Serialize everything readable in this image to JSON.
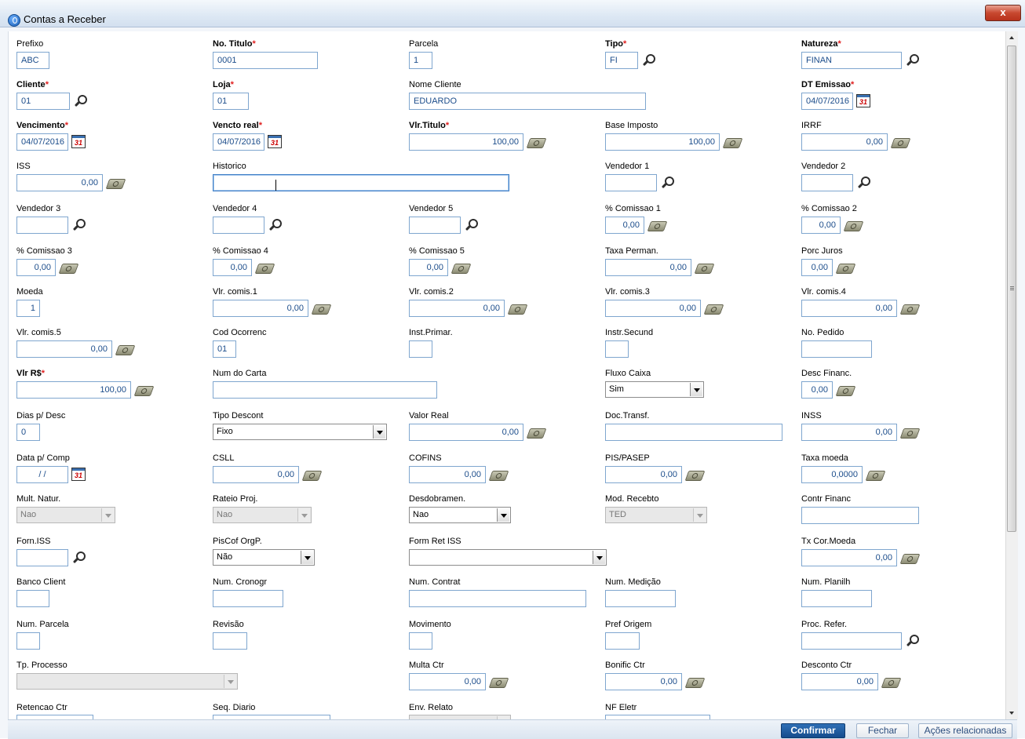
{
  "window": {
    "title": "Contas a Receber",
    "close_glyph": "x"
  },
  "fields": {
    "prefixo": {
      "label": "Prefixo",
      "value": "ABC"
    },
    "no_titulo": {
      "label": "No. Titulo",
      "value": "0001"
    },
    "parcela": {
      "label": "Parcela",
      "value": "1"
    },
    "tipo": {
      "label": "Tipo",
      "value": "FI"
    },
    "natureza": {
      "label": "Natureza",
      "value": "FINAN"
    },
    "cliente": {
      "label": "Cliente",
      "value": "01"
    },
    "loja": {
      "label": "Loja",
      "value": "01"
    },
    "nome_cliente": {
      "label": "Nome Cliente",
      "value": "EDUARDO"
    },
    "dt_emissao": {
      "label": "DT Emissao",
      "value": "04/07/2016"
    },
    "vencimento": {
      "label": "Vencimento",
      "value": "04/07/2016"
    },
    "vencto_real": {
      "label": "Vencto real",
      "value": "04/07/2016"
    },
    "vlr_titulo": {
      "label": "Vlr.Titulo",
      "value": "100,00"
    },
    "base_imposto": {
      "label": "Base Imposto",
      "value": "100,00"
    },
    "irrf": {
      "label": "IRRF",
      "value": "0,00"
    },
    "iss": {
      "label": "ISS",
      "value": "0,00"
    },
    "historico": {
      "label": "Historico",
      "value": ""
    },
    "vendedor1": {
      "label": "Vendedor 1",
      "value": ""
    },
    "vendedor2": {
      "label": "Vendedor 2",
      "value": ""
    },
    "vendedor3": {
      "label": "Vendedor 3",
      "value": ""
    },
    "vendedor4": {
      "label": "Vendedor 4",
      "value": ""
    },
    "vendedor5": {
      "label": "Vendedor 5",
      "value": ""
    },
    "comissao1": {
      "label": "% Comissao 1",
      "value": "0,00"
    },
    "comissao2": {
      "label": "% Comissao 2",
      "value": "0,00"
    },
    "comissao3": {
      "label": "% Comissao 3",
      "value": "0,00"
    },
    "comissao4": {
      "label": "% Comissao 4",
      "value": "0,00"
    },
    "comissao5": {
      "label": "% Comissao 5",
      "value": "0,00"
    },
    "taxa_perman": {
      "label": "Taxa Perman.",
      "value": "0,00"
    },
    "porc_juros": {
      "label": "Porc Juros",
      "value": "0,00"
    },
    "moeda": {
      "label": "Moeda",
      "value": "1"
    },
    "vlr_comis1": {
      "label": "Vlr. comis.1",
      "value": "0,00"
    },
    "vlr_comis2": {
      "label": "Vlr. comis.2",
      "value": "0,00"
    },
    "vlr_comis3": {
      "label": "Vlr. comis.3",
      "value": "0,00"
    },
    "vlr_comis4": {
      "label": "Vlr. comis.4",
      "value": "0,00"
    },
    "vlr_comis5": {
      "label": "Vlr. comis.5",
      "value": "0,00"
    },
    "cod_ocorrenc": {
      "label": "Cod Ocorrenc",
      "value": "01"
    },
    "inst_primar": {
      "label": "Inst.Primar.",
      "value": ""
    },
    "instr_secund": {
      "label": "Instr.Secund",
      "value": ""
    },
    "no_pedido": {
      "label": "No. Pedido",
      "value": ""
    },
    "vlr_rs": {
      "label": "Vlr R$",
      "value": "100,00"
    },
    "num_carta": {
      "label": "Num do Carta",
      "value": ""
    },
    "fluxo_caixa": {
      "label": "Fluxo Caixa",
      "value": "Sim"
    },
    "desc_financ": {
      "label": "Desc Financ.",
      "value": "0,00"
    },
    "dias_desc": {
      "label": "Dias p/ Desc",
      "value": "0"
    },
    "tipo_descont": {
      "label": "Tipo Descont",
      "value": "Fixo"
    },
    "valor_real": {
      "label": "Valor Real",
      "value": "0,00"
    },
    "doc_transf": {
      "label": "Doc.Transf.",
      "value": ""
    },
    "inss": {
      "label": "INSS",
      "value": "0,00"
    },
    "data_comp": {
      "label": "Data p/ Comp",
      "value": "/ /"
    },
    "csll": {
      "label": "CSLL",
      "value": "0,00"
    },
    "cofins": {
      "label": "COFINS",
      "value": "0,00"
    },
    "pis_pasep": {
      "label": "PIS/PASEP",
      "value": "0,00"
    },
    "taxa_moeda": {
      "label": "Taxa moeda",
      "value": "0,0000"
    },
    "mult_natur": {
      "label": "Mult. Natur.",
      "value": "Nao"
    },
    "rateio_proj": {
      "label": "Rateio Proj.",
      "value": "Nao"
    },
    "desdobramen": {
      "label": "Desdobramen.",
      "value": "Nao"
    },
    "mod_recebto": {
      "label": "Mod. Recebto",
      "value": "TED"
    },
    "contr_financ": {
      "label": "Contr Financ",
      "value": ""
    },
    "forn_iss": {
      "label": "Forn.ISS",
      "value": ""
    },
    "piscof_orgp": {
      "label": "PisCof OrgP.",
      "value": "Não"
    },
    "form_ret_iss": {
      "label": "Form Ret ISS",
      "value": ""
    },
    "tx_cor_moeda": {
      "label": "Tx Cor.Moeda",
      "value": "0,00"
    },
    "banco_client": {
      "label": "Banco Client",
      "value": ""
    },
    "num_cronogr": {
      "label": "Num. Cronogr",
      "value": ""
    },
    "num_contrat": {
      "label": "Num. Contrat",
      "value": ""
    },
    "num_medicao": {
      "label": "Num. Medição",
      "value": ""
    },
    "num_planilh": {
      "label": "Num. Planilh",
      "value": ""
    },
    "num_parcela": {
      "label": "Num. Parcela",
      "value": ""
    },
    "revisao": {
      "label": "Revisão",
      "value": ""
    },
    "movimento": {
      "label": "Movimento",
      "value": ""
    },
    "pref_origem": {
      "label": "Pref Origem",
      "value": ""
    },
    "proc_refer": {
      "label": "Proc. Refer.",
      "value": ""
    },
    "tp_processo": {
      "label": "Tp. Processo",
      "value": ""
    },
    "multa_ctr": {
      "label": "Multa Ctr",
      "value": "0,00"
    },
    "bonific_ctr": {
      "label": "Bonific Ctr",
      "value": "0,00"
    },
    "desconto_ctr": {
      "label": "Desconto Ctr",
      "value": "0,00"
    },
    "retencao_ctr": {
      "label": "Retencao Ctr"
    },
    "seq_diario": {
      "label": "Seq. Diario"
    },
    "env_relato": {
      "label": "Env. Relato"
    },
    "nf_eletr": {
      "label": "NF Eletr"
    }
  },
  "required_marker": "*",
  "calendar_glyph": "31",
  "buttons": {
    "confirmar": "Confirmar",
    "fechar": "Fechar",
    "acoes": "Ações relacionadas"
  },
  "colors": {
    "required_star": "#e02020",
    "field_text": "#1c4d8b",
    "primary_button": "#1a5aa0"
  }
}
